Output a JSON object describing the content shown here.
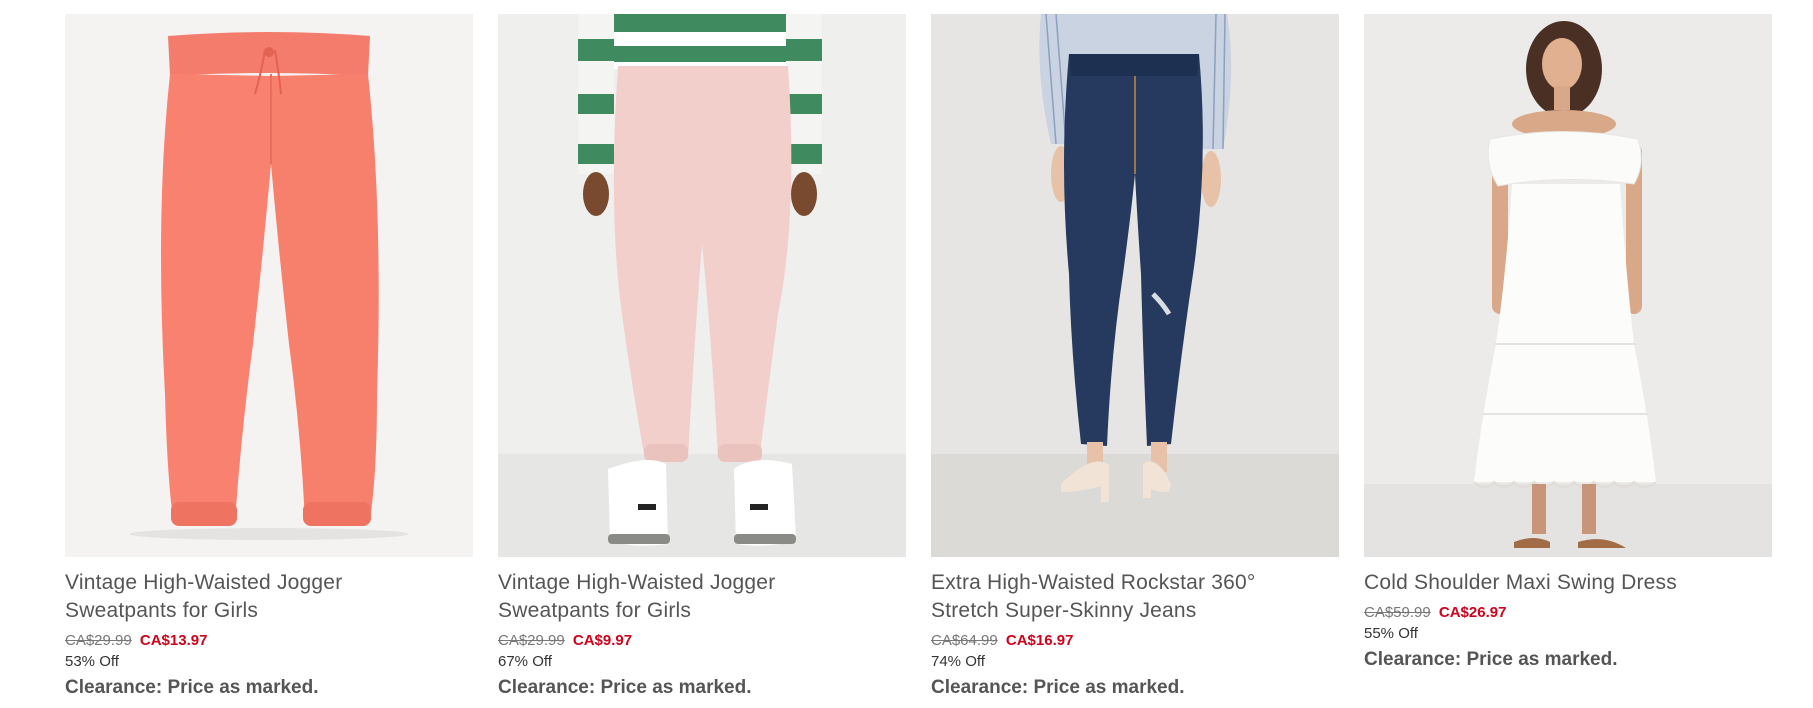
{
  "products": [
    {
      "title_line1": "Vintage High-Waisted Jogger",
      "title_line2": "Sweatpants for Girls",
      "original_price": "CA$29.99",
      "sale_price": "CA$13.97",
      "discount": "53% Off",
      "clearance": "Clearance: Price as marked.",
      "image": "coral-jogger-sweatpants"
    },
    {
      "title_line1": "Vintage High-Waisted Jogger",
      "title_line2": "Sweatpants for Girls",
      "original_price": "CA$29.99",
      "sale_price": "CA$9.97",
      "discount": "67% Off",
      "clearance": "Clearance: Price as marked.",
      "image": "pink-jogger-sweatpants-on-model"
    },
    {
      "title_line1": "Extra High-Waisted Rockstar 360°",
      "title_line2": "Stretch Super-Skinny Jeans",
      "original_price": "CA$64.99",
      "sale_price": "CA$16.97",
      "discount": "74% Off",
      "clearance": "Clearance: Price as marked.",
      "image": "dark-wash-skinny-jeans-on-model"
    },
    {
      "title_line1": "Cold Shoulder Maxi Swing Dress",
      "title_line2": "",
      "original_price": "CA$59.99",
      "sale_price": "CA$26.97",
      "discount": "55% Off",
      "clearance": "Clearance: Price as marked.",
      "image": "white-maxi-dress-on-model"
    }
  ],
  "colors": {
    "sale_red": "#d0021b",
    "title_gray": "#555555",
    "strike_gray": "#777777"
  }
}
